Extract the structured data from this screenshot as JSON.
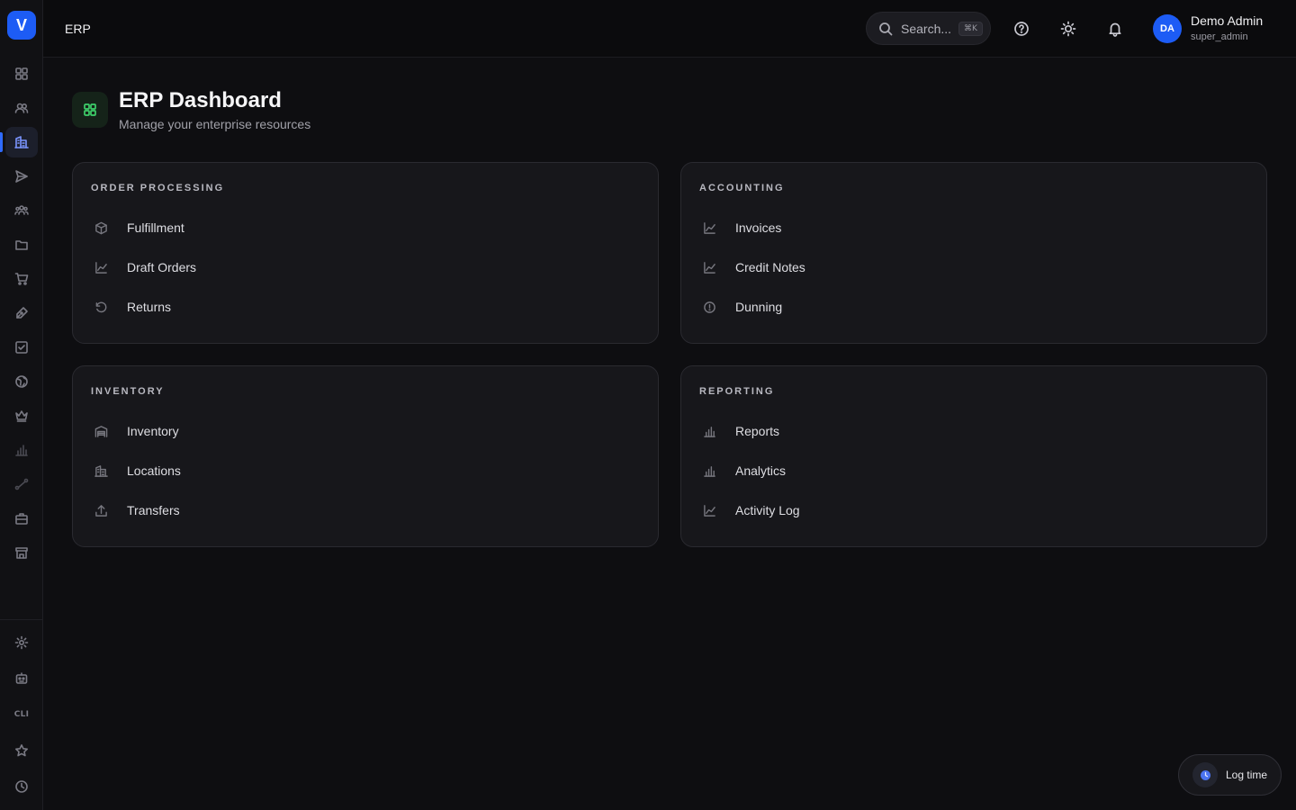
{
  "sidebar": {
    "logo": "V",
    "cli_label": "CLI",
    "items": [
      {
        "icon": "grid-icon"
      },
      {
        "icon": "users-icon"
      },
      {
        "icon": "building-icon",
        "active": true
      },
      {
        "icon": "send-icon"
      },
      {
        "icon": "team-icon"
      },
      {
        "icon": "folder-icon"
      },
      {
        "icon": "cart-icon"
      },
      {
        "icon": "pen-icon"
      },
      {
        "icon": "checkbox-icon"
      },
      {
        "icon": "globe-icon"
      },
      {
        "icon": "crown-icon"
      },
      {
        "icon": "bar-chart-icon"
      },
      {
        "icon": "route-icon"
      },
      {
        "icon": "briefcase-icon"
      },
      {
        "icon": "store-icon"
      }
    ],
    "bottom_items": [
      {
        "icon": "gear-icon"
      },
      {
        "icon": "robot-icon"
      },
      {
        "icon": "cli-icon"
      },
      {
        "icon": "star-icon"
      },
      {
        "icon": "clock-icon"
      }
    ]
  },
  "topbar": {
    "title": "ERP",
    "search_placeholder": "Search...",
    "search_shortcut": "⌘K",
    "user": {
      "initials": "DA",
      "name": "Demo Admin",
      "role": "super_admin"
    }
  },
  "header": {
    "title": "ERP Dashboard",
    "subtitle": "Manage your enterprise resources"
  },
  "cards": [
    {
      "title": "ORDER PROCESSING",
      "items": [
        {
          "label": "Fulfillment",
          "icon": "box-icon"
        },
        {
          "label": "Draft Orders",
          "icon": "trend-icon"
        },
        {
          "label": "Returns",
          "icon": "undo-icon"
        }
      ]
    },
    {
      "title": "ACCOUNTING",
      "items": [
        {
          "label": "Invoices",
          "icon": "trend-icon"
        },
        {
          "label": "Credit Notes",
          "icon": "trend-icon"
        },
        {
          "label": "Dunning",
          "icon": "alert-circle-icon"
        }
      ]
    },
    {
      "title": "INVENTORY",
      "items": [
        {
          "label": "Inventory",
          "icon": "warehouse-icon"
        },
        {
          "label": "Locations",
          "icon": "building-icon"
        },
        {
          "label": "Transfers",
          "icon": "upload-icon"
        }
      ]
    },
    {
      "title": "REPORTING",
      "items": [
        {
          "label": "Reports",
          "icon": "bar-chart-icon"
        },
        {
          "label": "Analytics",
          "icon": "bar-chart-icon"
        },
        {
          "label": "Activity Log",
          "icon": "trend-icon"
        }
      ]
    }
  ],
  "log_time": {
    "label": "Log time"
  },
  "colors": {
    "accent": "#1d5cf5",
    "success": "#3ecf6a",
    "background": "#0e0e11",
    "card": "#17171b"
  }
}
